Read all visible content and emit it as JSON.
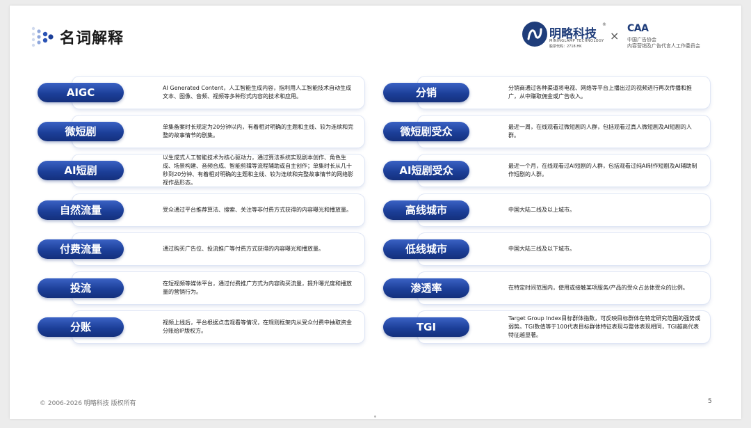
{
  "page": {
    "title": "名词解释",
    "footer_copyright": "© 2006-2026 明略科技 版权所有",
    "page_number": "5"
  },
  "brand": {
    "name": "明略科技",
    "registered_mark": "®",
    "sub_line1": "MININGLAMP TECHNOLOGY",
    "sub_line2": "股票代码：2718.HK",
    "times": "×",
    "partner_logo": "CAA",
    "partner_line1": "中国广告协会",
    "partner_line2": "内容营销及广告代言人工作委员会"
  },
  "colors": {
    "pill_top": "#3b62c4",
    "pill_bottom": "#14307c",
    "brand_blue": "#1f3d7a"
  },
  "left_terms": [
    {
      "term": "AIGC",
      "desc": "AI Generated Content，人工智能生成内容，指利用人工智能技术自动生成文本、图像、音频、视频等多种形式内容的技术和应用。"
    },
    {
      "term": "微短剧",
      "desc": "单集备案时长规定为20分钟以内，有着相对明确的主题和主线、较为连续和完整的故事情节的剧集。"
    },
    {
      "term": "AI短剧",
      "desc": "以生成式人工智能技术为核心驱动力，通过算法系统实现剧本创作、角色生成、场景构建、音频合成、智能剪辑等流程辅助或自主创作；单集时长从几十秒到20分钟、有着相对明确的主题和主线、较为连续和完整故事情节的网络影视作品形态。"
    },
    {
      "term": "自然流量",
      "desc": "受众通过平台推荐算法、搜索、关注等非付费方式获得的内容曝光和播放量。"
    },
    {
      "term": "付费流量",
      "desc": "通过购买广告位、投流推广等付费方式获得的内容曝光和播放量。"
    },
    {
      "term": "投流",
      "desc": "在短视频等媒体平台，通过付费推广方式为内容购买流量，提升曝光度和播放量的营销行为。"
    },
    {
      "term": "分账",
      "desc": "视频上线后，平台根据点击观看等情况，在规则框架内从受众付费中抽取资金分账给IP版权方。"
    }
  ],
  "right_terms": [
    {
      "term": "分销",
      "desc": "分销商通过各种渠道将电视、网络等平台上播出过的视频进行再次传播和推广，从中赚取佣金或广告收入。"
    },
    {
      "term": "微短剧受众",
      "desc": "最近一周，在线观看过微短剧的人群，包括观看过真人微短剧及AI短剧的人群。"
    },
    {
      "term": "AI短剧受众",
      "desc": "最近一个月，在线观看过AI短剧的人群，包括观看过纯AI制作短剧及AI辅助制作短剧的人群。"
    },
    {
      "term": "高线城市",
      "desc": "中国大陆二线及以上城市。"
    },
    {
      "term": "低线城市",
      "desc": "中国大陆三线及以下城市。"
    },
    {
      "term": "渗透率",
      "desc": "在特定时间范围内，使用或接触某项服务/产品的受众占总体受众的比例。"
    },
    {
      "term": "TGI",
      "desc": "Target Group Index目标群体指数，可反映目标群体在特定研究范围的强势或弱势。TGI数值等于100代表目标群体特征表现与整体表现相同，TGI越高代表特征越显著。"
    }
  ]
}
